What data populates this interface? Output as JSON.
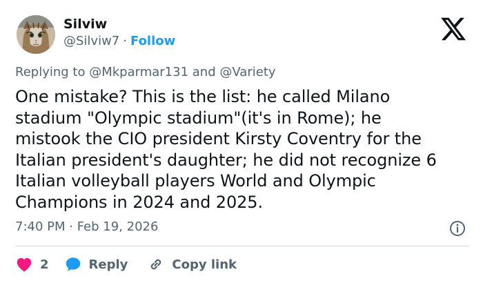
{
  "author": {
    "name": "Silviw",
    "handle": "@Silviw7",
    "separator": "·",
    "follow_label": "Follow"
  },
  "reply_context": {
    "prefix": "Replying to",
    "mention_1": "@Mkparmar131",
    "conjunction": "and",
    "mention_2": "@Variety"
  },
  "tweet": {
    "lines": [
      "One mistake? This is the list: he called Milano",
      "stadium \"Olympic stadium\"(it's in Rome); he",
      "mistook the CIO president Kirsty Coventry for the",
      "Italian president's daughter; he did not recognize 6",
      "Italian volleyball players World and Olympic",
      "Champions in 2024 and 2025."
    ],
    "timestamp": "7:40 PM · Feb 19, 2026"
  },
  "actions": {
    "like_count": "2",
    "reply_label": "Reply",
    "copy_label": "Copy link"
  },
  "icons": {
    "logo": "x-logo-icon",
    "info": "info-icon",
    "like": "heart-icon",
    "reply": "speech-bubble-icon",
    "copy": "link-icon"
  },
  "colors": {
    "text": "#0f1419",
    "muted": "#536471",
    "accent": "#1d9bf0",
    "like": "#f91880",
    "divider": "#cfd9de"
  }
}
